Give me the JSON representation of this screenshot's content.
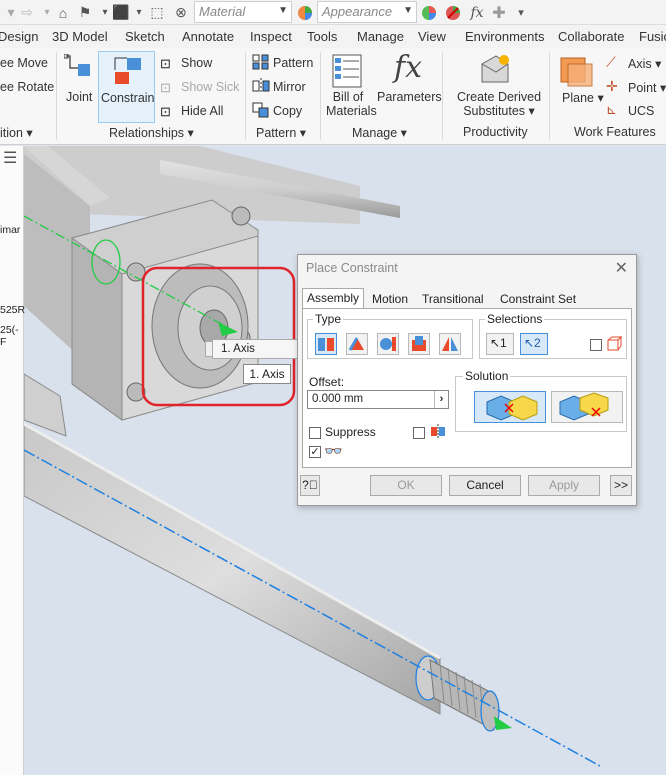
{
  "qat": {
    "material_placeholder": "Material",
    "appearance_placeholder": "Appearance",
    "fx_label": "fx"
  },
  "tabs": [
    "Design",
    "3D Model",
    "Sketch",
    "Annotate",
    "Inspect",
    "Tools",
    "Manage",
    "View",
    "Environments",
    "Collaborate",
    "Fusio"
  ],
  "ribbon": {
    "position_items": [
      "ee Move",
      "ee Rotate"
    ],
    "position_label": "ition",
    "joint": "Joint",
    "constrain": "Constrain",
    "show": "Show",
    "show_sick": "Show Sick",
    "hide_all": "Hide All",
    "relationships_label": "Relationships",
    "pattern": "Pattern",
    "mirror": "Mirror",
    "copy": "Copy",
    "pattern_label": "Pattern",
    "bom_line1": "Bill of",
    "bom_line2": "Materials",
    "parameters": "Parameters",
    "manage_label": "Manage",
    "cds_line1": "Create Derived",
    "cds_line2": "Substitutes",
    "productivity_label": "Productivity",
    "plane": "Plane",
    "axis": "Axis",
    "point": "Point",
    "ucs": "UCS",
    "work_features_label": "Work Features"
  },
  "browser_fragments": [
    "imar",
    "525R",
    "25(-F"
  ],
  "dialog": {
    "title": "Place Constraint",
    "tabs": [
      "Assembly",
      "Motion",
      "Transitional",
      "Constraint Set"
    ],
    "type_label": "Type",
    "selections_label": "Selections",
    "offset_label": "Offset:",
    "offset_value": "0.000 mm",
    "solution_label": "Solution",
    "suppress_label": "Suppress",
    "ok": "OK",
    "cancel": "Cancel",
    "apply": "Apply",
    "more": ">>"
  },
  "axis_dropdown": {
    "value": "1. Axis",
    "tooltip": "1. Axis"
  },
  "colors": {
    "highlight_red": "#e0242c",
    "axis_green": "#22cc44",
    "axis_blue": "#1e7fe0",
    "accent_blue": "#4a90d9"
  }
}
